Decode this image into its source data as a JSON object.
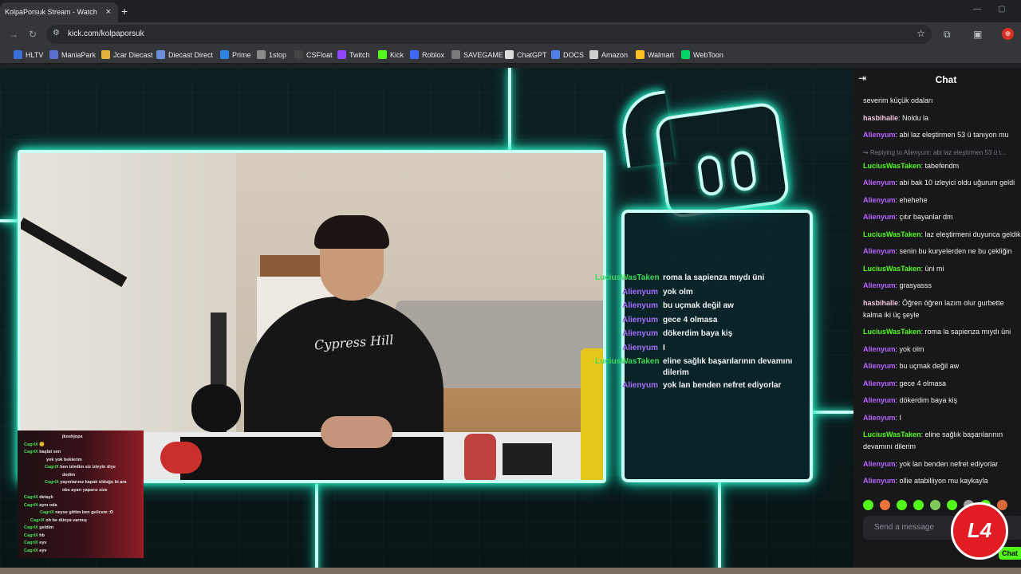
{
  "browser": {
    "tab_title": "KolpaPorsuk Stream - Watch Li",
    "tab_close": "×",
    "new_tab": "+",
    "url": "kick.com/kolpaporsuk",
    "profile_badge": "◎",
    "bookmarks": [
      {
        "label": "HLTV",
        "color": "#3b6fd8"
      },
      {
        "label": "ManiaPark",
        "color": "#5a6fd0"
      },
      {
        "label": "Jcar Diecast",
        "color": "#e2b23a"
      },
      {
        "label": "Diecast Direct",
        "color": "#6b8fd9"
      },
      {
        "label": "Prime",
        "color": "#2e82e0"
      },
      {
        "label": "1stop",
        "color": "#8a8a8a"
      },
      {
        "label": "CSFloat",
        "color": "#444444"
      },
      {
        "label": "Twitch",
        "color": "#9146ff"
      },
      {
        "label": "Kick",
        "color": "#53fc18"
      },
      {
        "label": "Roblox",
        "color": "#3e68ff"
      },
      {
        "label": "SAVEGAME",
        "color": "#7a7a7a"
      },
      {
        "label": "ChatGPT",
        "color": "#dddddd"
      },
      {
        "label": "DOCS",
        "color": "#4f7fe8"
      },
      {
        "label": "Amazon",
        "color": "#cfcfcf"
      },
      {
        "label": "Walmart",
        "color": "#ffc220"
      },
      {
        "label": "WebToon",
        "color": "#00d564"
      }
    ]
  },
  "overlay": {
    "shirt_text": "Cypress Hill",
    "messages": [
      {
        "user": "LuciusWasTaken",
        "text": "roma la sapienza mıydı üni",
        "color": "green"
      },
      {
        "user": "Alienyum",
        "text": "yok olm",
        "color": "purple"
      },
      {
        "user": "Alienyum",
        "text": "bu uçmak değil aw",
        "color": "purple"
      },
      {
        "user": "Alienyum",
        "text": "gece 4 olmasa",
        "color": "purple"
      },
      {
        "user": "Alienyum",
        "text": "dökerdim baya kiş",
        "color": "purple"
      },
      {
        "user": "Alienyum",
        "text": "I",
        "color": "purple"
      },
      {
        "user": "LuciusWasTaken",
        "text": "eline sağlık başarılarının devamını dilerim",
        "color": "green"
      },
      {
        "user": "Alienyum",
        "text": "yok lan benden nefret ediyorlar",
        "color": "purple"
      }
    ]
  },
  "mini_chat": [
    {
      "user": "",
      "text": "jkoshjops",
      "indent": 56
    },
    {
      "user": "CagriX",
      "text": "😊",
      "indent": 8
    },
    {
      "user": "CagriX",
      "text": "başlat sen",
      "indent": 8
    },
    {
      "user": "",
      "text": "yok yok beklerim",
      "indent": 36
    },
    {
      "user": "CagriX",
      "text": "ben izledim siz izleyin diye",
      "indent": 34
    },
    {
      "user": "",
      "text": "dedim",
      "indent": 56
    },
    {
      "user": "CagriX",
      "text": "yayınlarınız kapalı olduğu bi ara",
      "indent": 34
    },
    {
      "user": "",
      "text": "obs ayarı yaparız size",
      "indent": 56
    },
    {
      "user": "CagriX",
      "text": "detaylı",
      "indent": 8
    },
    {
      "user": "CagriX",
      "text": "aynı oda",
      "indent": 8
    },
    {
      "user": "CagriX",
      "text": "neyse gittim ben gelicem :D",
      "indent": 28
    },
    {
      "user": "CagriX",
      "text": "oh be dünya varmış",
      "indent": 16
    },
    {
      "user": "CagriX",
      "text": "geldim",
      "indent": 8
    },
    {
      "user": "CagriX",
      "text": "hb",
      "indent": 8
    },
    {
      "user": "CagriX",
      "text": "eyv",
      "indent": 8
    },
    {
      "user": "CagriX",
      "text": "eyv",
      "indent": 8
    }
  ],
  "chat": {
    "title": "Chat",
    "messages": [
      {
        "user": "",
        "text": "severim küçük odaları",
        "color": "purple",
        "single": true
      },
      {
        "user": "hasbihalle",
        "text": "Noldu la",
        "color": "pink",
        "single": true
      },
      {
        "user": "Alienyum",
        "text": "abi laz eleştirmen 53 ü tanıyon mu",
        "color": "purple",
        "single": true
      },
      {
        "reply": "↪ Replying to Alienyum: abi laz eleştirmen 53 ü t..."
      },
      {
        "user": "LuciusWasTaken",
        "text": "tabefendm",
        "color": "green",
        "single": true
      },
      {
        "user": "Alienyum",
        "text": "abi bak 10 izleyici oldu uğurum geldi",
        "color": "purple",
        "single": true
      },
      {
        "user": "Alienyum",
        "text": "ehehehe",
        "color": "purple",
        "single": true
      },
      {
        "user": "Alienyum",
        "text": "çıtır bayanlar dm",
        "color": "purple",
        "single": true
      },
      {
        "user": "LuciusWasTaken",
        "text": "laz eleştirmeni duyunca geldik",
        "color": "green",
        "single": false
      },
      {
        "user": "Alienyum",
        "text": "senin bu kuryelerden ne bu çekliğin",
        "color": "purple",
        "single": true
      },
      {
        "user": "LuciusWasTaken",
        "text": "üni mi",
        "color": "green",
        "single": true
      },
      {
        "user": "Alienyum",
        "text": "grasyasss",
        "color": "purple",
        "single": true
      },
      {
        "user": "hasbihalle",
        "text": "Öğren öğren lazım olur gurbette kalma iki üç şeyle",
        "color": "pink",
        "single": false
      },
      {
        "user": "LuciusWasTaken",
        "text": "roma la sapienza mıydı üni",
        "color": "green",
        "single": true
      },
      {
        "user": "Alienyum",
        "text": "yok olm",
        "color": "purple",
        "single": true
      },
      {
        "user": "Alienyum",
        "text": "bu uçmak değil aw",
        "color": "purple",
        "single": true
      },
      {
        "user": "Alienyum",
        "text": "gece 4 olmasa",
        "color": "purple",
        "single": true
      },
      {
        "user": "Alienyum",
        "text": "dökerdim baya kiş",
        "color": "purple",
        "single": true
      },
      {
        "user": "Alienyum",
        "text": "I",
        "color": "purple",
        "single": true
      },
      {
        "user": "LuciusWasTaken",
        "text": "eline sağlık başarılarının devamını dilerim",
        "color": "green",
        "single": false
      },
      {
        "user": "Alienyum",
        "text": "yok lan benden nefret ediyorlar",
        "color": "purple",
        "single": true
      },
      {
        "user": "Alienyum",
        "text": "ollie atabiliiyon mu kaykayla",
        "color": "purple",
        "single": true
      }
    ],
    "emote_colors": [
      "#53fc18",
      "#e8743b",
      "#53fc18",
      "#53fc18",
      "#7ecb5a",
      "#53fc18",
      "#a0a0a0",
      "#53fc18",
      "#d86a3a"
    ],
    "send_placeholder": "Send a message",
    "send_label": "Chat",
    "badge_text": "L4"
  },
  "colors": {
    "kick_green": "#53fc18",
    "neon": "#34ffd2",
    "purple_user": "#b562ff"
  }
}
